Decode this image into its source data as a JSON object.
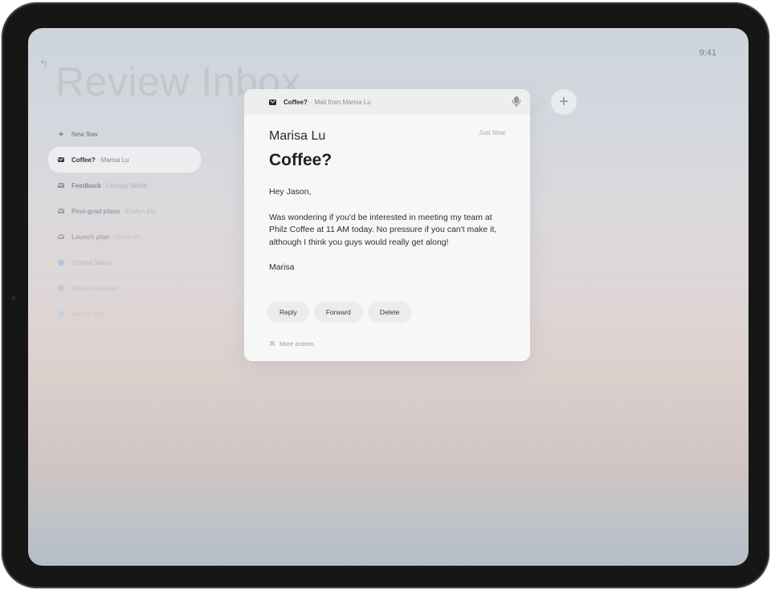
{
  "status_bar": {
    "time": "9:41"
  },
  "page": {
    "title": "Review Inbox",
    "back_icon": "back-arrow-icon"
  },
  "sidebar": {
    "new_flow_label": "New flow",
    "items": [
      {
        "primary": "Coffee?",
        "secondary": "Marisa Lu",
        "icon": "mail-icon",
        "active": true
      },
      {
        "primary": "Feedback",
        "secondary": "Lindsay Webb",
        "icon": "mail-icon"
      },
      {
        "primary": "Post-grad plans",
        "secondary": "Evelyn Ma",
        "icon": "mail-icon"
      },
      {
        "primary": "Launch plan",
        "secondary": "Oliver Im",
        "icon": "mail-icon"
      },
      {
        "primary": "Victoria Wang",
        "icon": "person-icon"
      },
      {
        "primary": "Advait Kalakkad",
        "icon": "person-icon"
      },
      {
        "primary": "Danny Trinh",
        "icon": "person-icon"
      }
    ]
  },
  "card": {
    "header": {
      "subject": "Coffee?",
      "source": "Mail from Marisa Lu"
    },
    "sender": "Marisa Lu",
    "timestamp": "Just Now",
    "subject": "Coffee?",
    "greeting": "Hey Jason,",
    "paragraph": "Was wondering if you'd be interested in meeting my team at Philz Coffee at 11 AM today. No pressure if you can't make it, although I think you guys would really get along!",
    "signoff": "Marisa",
    "actions": {
      "reply": "Reply",
      "forward": "Forward",
      "delete": "Delete"
    },
    "more_actions": "More actions",
    "more_actions_glyph": "⌘"
  },
  "add_button": {
    "symbol": "+"
  }
}
